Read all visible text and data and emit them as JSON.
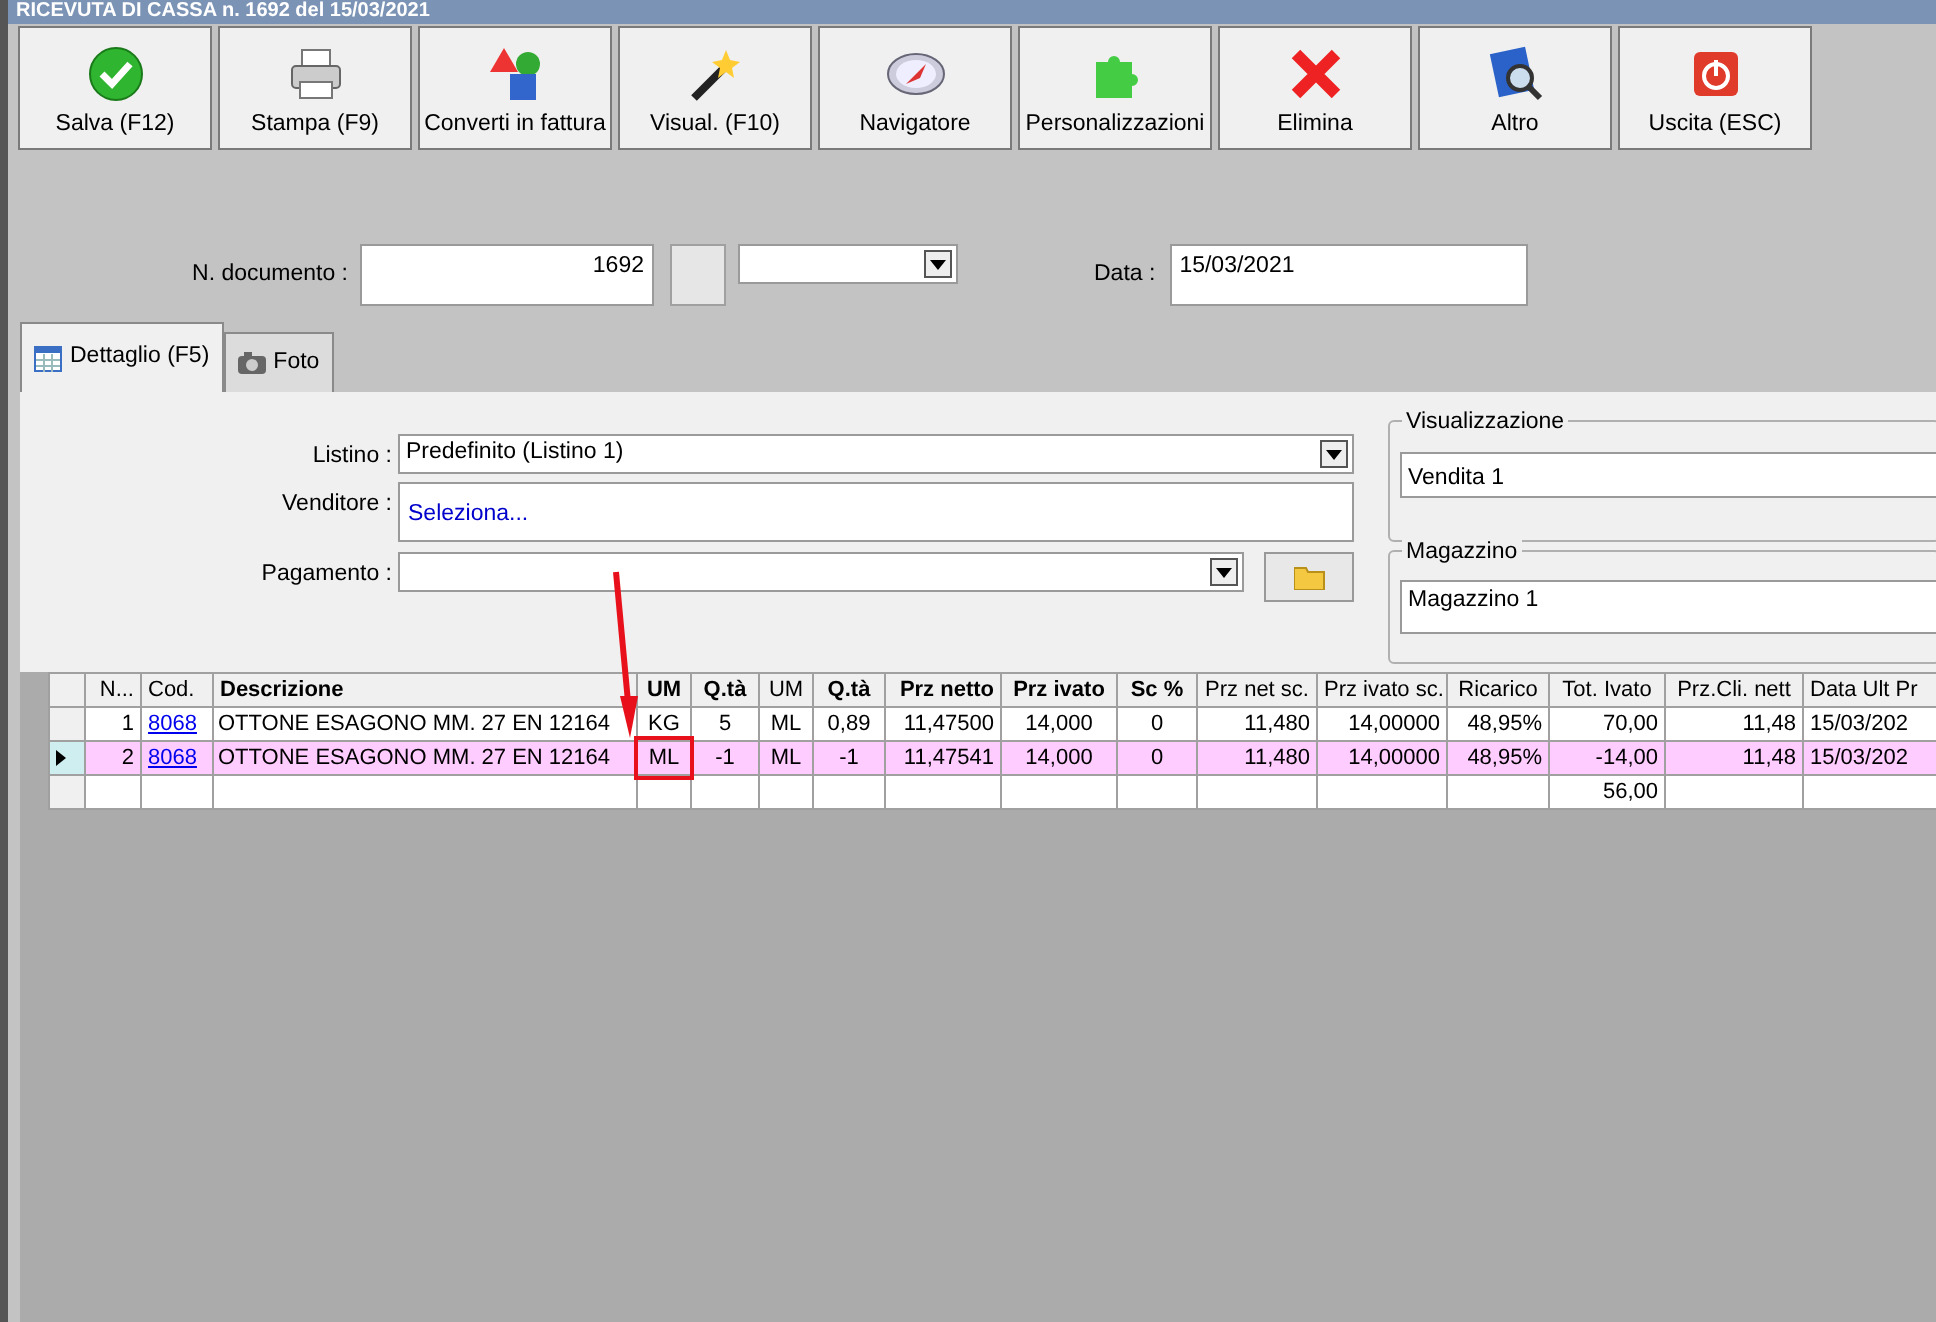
{
  "window": {
    "title": "RICEVUTA DI CASSA n. 1692 del 15/03/2021"
  },
  "toolbar": [
    {
      "label": "Salva (F12)",
      "kind": "check"
    },
    {
      "label": "Stampa (F9)",
      "kind": "printer"
    },
    {
      "label": "Converti in fattura",
      "kind": "convert"
    },
    {
      "label": "Visual. (F10)",
      "kind": "wand"
    },
    {
      "label": "Navigatore",
      "kind": "compass"
    },
    {
      "label": "Personalizzazioni",
      "kind": "puzzle"
    },
    {
      "label": "Elimina",
      "kind": "cross"
    },
    {
      "label": "Altro",
      "kind": "book"
    },
    {
      "label": "Uscita (ESC)",
      "kind": "power"
    }
  ],
  "document": {
    "number_label": "N. documento :",
    "number": "1692",
    "date_label": "Data :",
    "date": "15/03/2021"
  },
  "tabs": [
    {
      "label": "Dettaglio (F5)",
      "selected": true,
      "kind": "grid"
    },
    {
      "label": "Foto",
      "selected": false,
      "kind": "camera"
    }
  ],
  "form": {
    "listino_label": "Listino :",
    "listino": "Predefinito (Listino 1)",
    "venditore_label": "Venditore :",
    "venditore": "Seleziona...",
    "pagamento_label": "Pagamento :"
  },
  "groups": [
    {
      "title": "Visualizzazione",
      "value": "Vendita 1"
    },
    {
      "title": "Magazzino",
      "value": "Magazzino 1"
    }
  ],
  "table": {
    "columns": [
      {
        "label": "N...",
        "bold": false
      },
      {
        "label": "Cod.",
        "bold": false
      },
      {
        "label": "Descrizione",
        "bold": true
      },
      {
        "label": "UM",
        "bold": true
      },
      {
        "label": "Q.tà",
        "bold": true
      },
      {
        "label": "UM",
        "bold": false
      },
      {
        "label": "Q.tà",
        "bold": true
      },
      {
        "label": "Prz netto",
        "bold": true
      },
      {
        "label": "Prz ivato",
        "bold": true
      },
      {
        "label": "Sc %",
        "bold": true
      },
      {
        "label": "Prz net sc.",
        "bold": false
      },
      {
        "label": "Prz ivato sc.",
        "bold": false
      },
      {
        "label": "Ricarico",
        "bold": false
      },
      {
        "label": "Tot. Ivato",
        "bold": false
      },
      {
        "label": "Prz.Cli. nett",
        "bold": false
      },
      {
        "label": "Data Ult Pr",
        "bold": false
      }
    ],
    "rows": [
      {
        "selected": false,
        "annotated": false,
        "cells": [
          "1",
          "8068",
          "OTTONE ESAGONO MM.   27 EN 12164",
          "KG",
          "5",
          "ML",
          "0,89",
          "11,47500",
          "14,000",
          "0",
          "11,480",
          "14,00000",
          "48,95%",
          "70,00",
          "11,48",
          "15/03/202"
        ]
      },
      {
        "selected": true,
        "annotated": true,
        "cells": [
          "2",
          "8068",
          "OTTONE ESAGONO MM.   27 EN 12164",
          "ML",
          "-1",
          "ML",
          "-1",
          "11,47541",
          "14,000",
          "0",
          "11,480",
          "14,00000",
          "48,95%",
          "-14,00",
          "11,48",
          "15/03/202"
        ]
      }
    ],
    "totals": {
      "tot_ivato": "56,00"
    }
  }
}
